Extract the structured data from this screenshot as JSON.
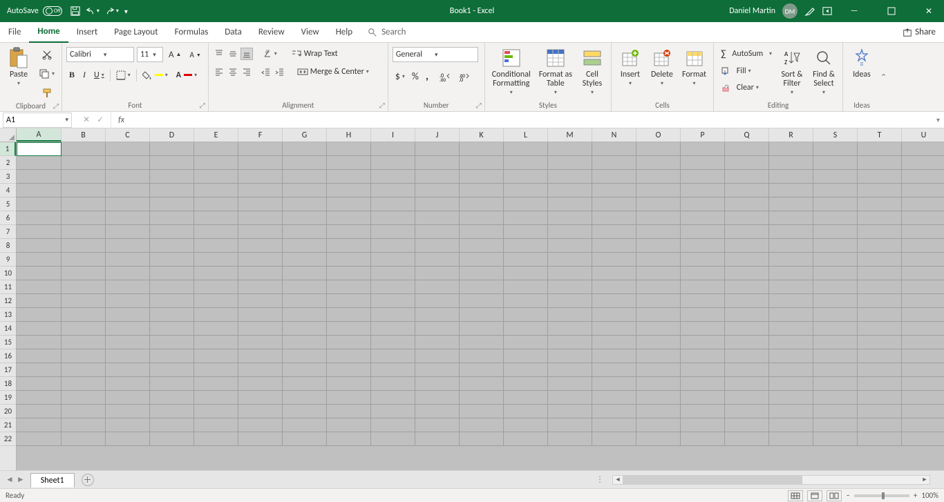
{
  "titlebar": {
    "autosave_label": "AutoSave",
    "autosave_state": "Off",
    "doc_title": "Book1  -  Excel",
    "user_name": "Daniel Martin",
    "user_initials": "DM"
  },
  "tabs": {
    "items": [
      "File",
      "Home",
      "Insert",
      "Page Layout",
      "Formulas",
      "Data",
      "Review",
      "View",
      "Help"
    ],
    "active_index": 1,
    "search_placeholder": "Search",
    "share_label": "Share"
  },
  "ribbon": {
    "clipboard": {
      "paste": "Paste",
      "label": "Clipboard"
    },
    "font": {
      "name": "Calibri",
      "size": "11",
      "label": "Font"
    },
    "alignment": {
      "wrap": "Wrap Text",
      "merge": "Merge & Center",
      "label": "Alignment"
    },
    "number": {
      "format": "General",
      "label": "Number"
    },
    "styles": {
      "cond": "Conditional\nFormatting",
      "fmt_table": "Format as\nTable",
      "cell_styles": "Cell\nStyles",
      "label": "Styles"
    },
    "cells": {
      "insert": "Insert",
      "delete": "Delete",
      "format": "Format",
      "label": "Cells"
    },
    "editing": {
      "autosum": "AutoSum",
      "fill": "Fill",
      "clear": "Clear",
      "sort": "Sort &\nFilter",
      "find": "Find &\nSelect",
      "label": "Editing"
    },
    "ideas": {
      "label": "Ideas",
      "btn": "Ideas"
    }
  },
  "formula_bar": {
    "name_box": "A1",
    "fx": "fx"
  },
  "grid": {
    "columns": [
      "A",
      "B",
      "C",
      "D",
      "E",
      "F",
      "G",
      "H",
      "I",
      "J",
      "K",
      "L",
      "M",
      "N",
      "O",
      "P",
      "Q",
      "R",
      "S",
      "T",
      "U"
    ],
    "row_count": 22,
    "active_col": 0,
    "active_row": 0
  },
  "sheet_tabs": {
    "active": "Sheet1"
  },
  "statusbar": {
    "ready": "Ready",
    "zoom": "100%"
  }
}
